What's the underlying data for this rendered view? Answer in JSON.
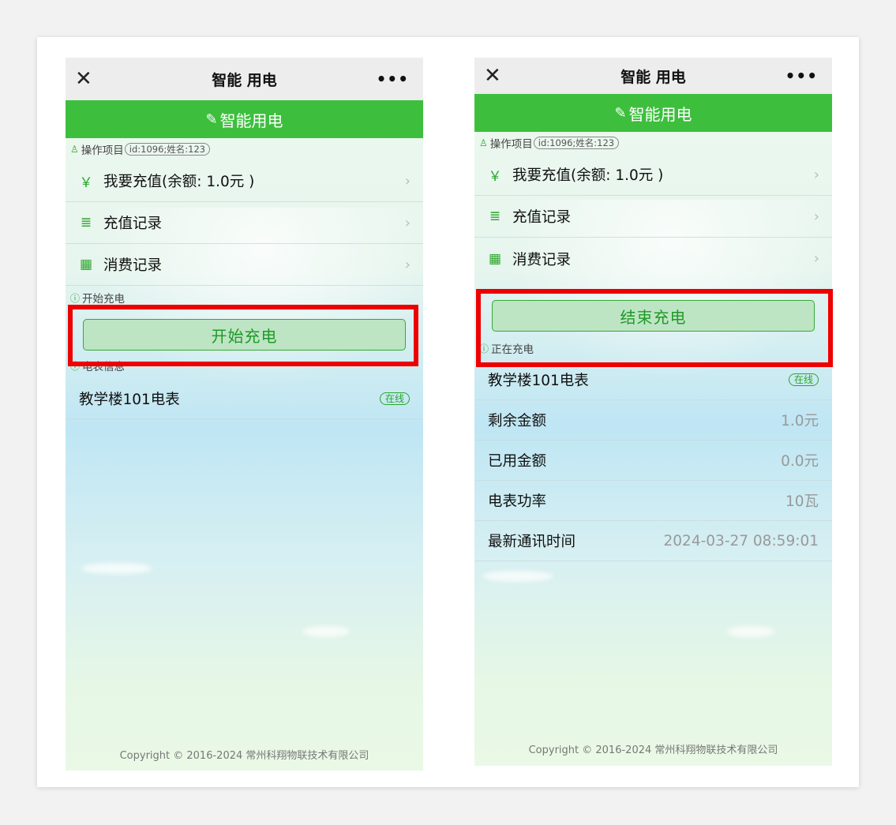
{
  "left": {
    "nav": {
      "close": "✕",
      "title": "智能 用电",
      "more": "•••"
    },
    "banner": {
      "plug_icon": "plug-icon",
      "title": "智能用电"
    },
    "project_section": {
      "label": "操作项目",
      "tag": "id:1096;姓名:123"
    },
    "menu": [
      {
        "icon": "￥",
        "label": "我要充值(余额: 1.0元 )"
      },
      {
        "icon": "≣",
        "label": "充值记录"
      },
      {
        "icon": "▦",
        "label": "消费记录"
      }
    ],
    "charge_section": {
      "label": "开始充电"
    },
    "charge_button": "开始充电",
    "meter_section": {
      "label": "电表信息"
    },
    "meter": {
      "name": "教学楼101电表",
      "status": "在线"
    },
    "copyright": "Copyright © 2016-2024 常州科翔物联技术有限公司"
  },
  "right": {
    "nav": {
      "close": "✕",
      "title": "智能 用电",
      "more": "•••"
    },
    "banner": {
      "plug_icon": "plug-icon",
      "title": "智能用电"
    },
    "project_section": {
      "label": "操作项目",
      "tag": "id:1096;姓名:123"
    },
    "menu": [
      {
        "icon": "￥",
        "label": "我要充值(余额: 1.0元 )"
      },
      {
        "icon": "≣",
        "label": "充值记录"
      },
      {
        "icon": "▦",
        "label": "消费记录"
      }
    ],
    "stop_button": "结束充电",
    "charging_section": {
      "label": "正在充电"
    },
    "meter": {
      "name": "教学楼101电表",
      "status": "在线"
    },
    "details": [
      {
        "label": "剩余金额",
        "value": "1.0元"
      },
      {
        "label": "已用金额",
        "value": "0.0元"
      },
      {
        "label": "电表功率",
        "value": "10瓦"
      },
      {
        "label": "最新通讯时间",
        "value": "2024-03-27 08:59:01"
      }
    ],
    "copyright": "Copyright © 2016-2024 常州科翔物联技术有限公司"
  },
  "colors": {
    "brand_green": "#3dbf3d",
    "highlight_red": "#ee0000",
    "button_fill": "#bde5c3"
  }
}
